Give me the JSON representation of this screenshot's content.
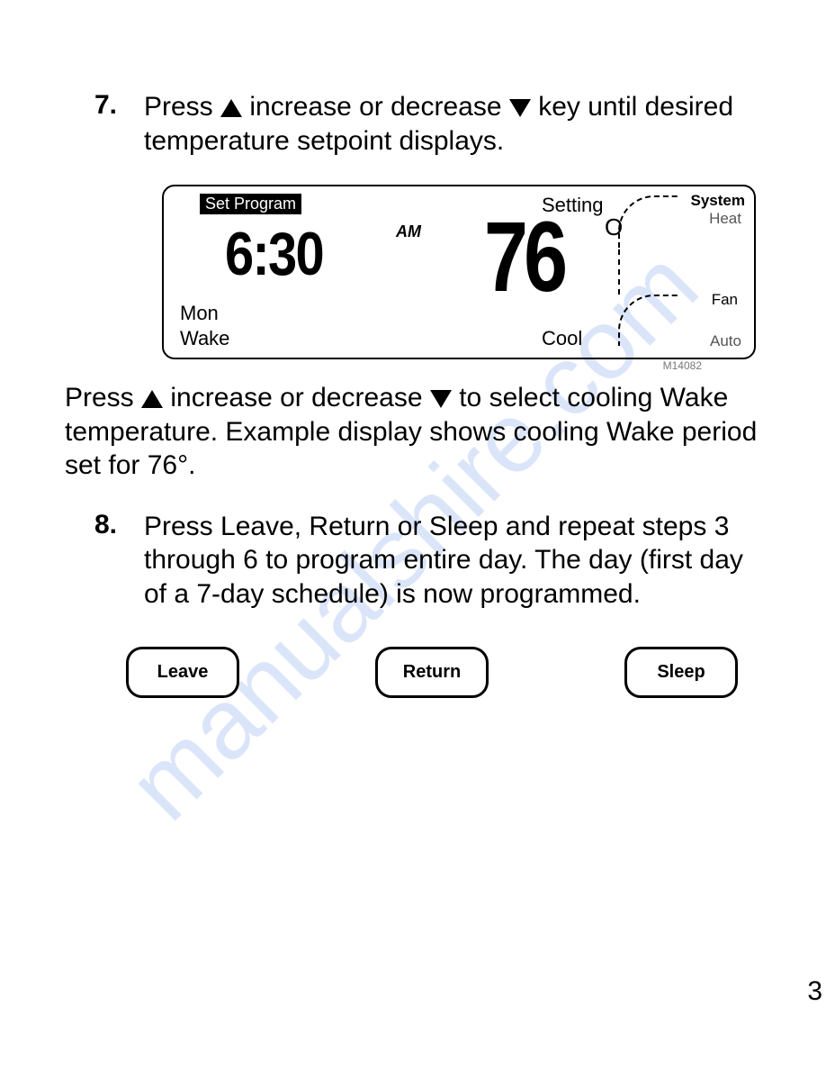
{
  "watermark": "manualshire.com",
  "page_number": "3",
  "step7": {
    "num": "7.",
    "text_before_up": "Press ",
    "text_mid": " increase or decrease ",
    "text_after_down": " key until desired temperature  setpoint displays."
  },
  "lcd": {
    "mode": "Set Program",
    "setting": "Setting",
    "system": "System",
    "heat": "Heat",
    "fan": "Fan",
    "auto": "Auto",
    "cool": "Cool",
    "day": "Mon",
    "period": "Wake",
    "time": "6:30",
    "ampm": "AM",
    "temp": "76",
    "deg": "O"
  },
  "figure_id": "M14082",
  "caption": {
    "prefix": "Press  ",
    "mid": " increase or decrease ",
    "suffix": "to select cooling Wake temperature. Example display shows cooling Wake period set for 76°."
  },
  "step8": {
    "num": "8.",
    "text": "Press Leave, Return or Sleep and repeat steps 3 through 6 to program entire day. The day (first day of a 7-day schedule) is now programmed."
  },
  "buttons": {
    "leave": "Leave",
    "return": "Return",
    "sleep": "Sleep"
  }
}
